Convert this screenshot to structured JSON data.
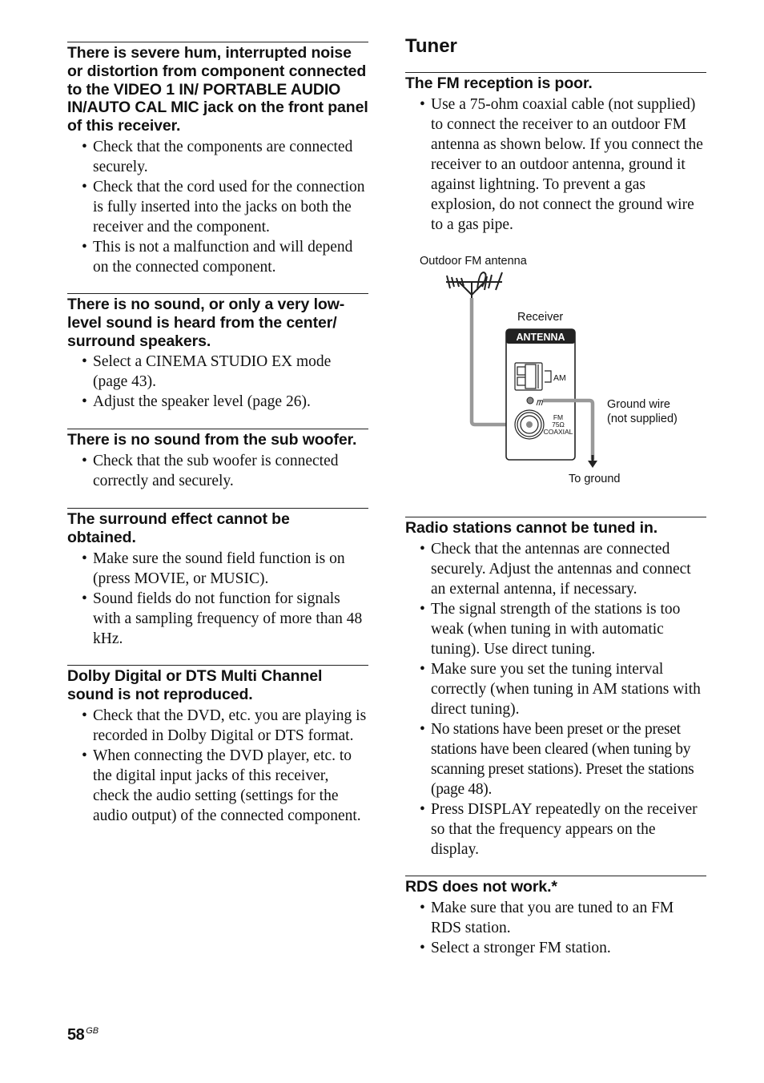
{
  "left_column": {
    "sections": [
      {
        "heading": "There is severe hum, interrupted noise or distortion from component connected to the VIDEO 1 IN/ PORTABLE AUDIO IN/AUTO CAL MIC jack on the front panel of this receiver.",
        "bullets": [
          "Check that the components are connected securely.",
          "Check that the cord used for the connection is fully inserted into the jacks on both the receiver and the component.",
          "This is not a malfunction and will depend on the connected component."
        ]
      },
      {
        "heading": "There is no sound, or only a very low-level sound is heard from the center/ surround speakers.",
        "bullets": [
          "Select a CINEMA STUDIO EX mode (page 43).",
          "Adjust the speaker level (page 26)."
        ]
      },
      {
        "heading": "There is no sound from the sub woofer.",
        "bullets": [
          "Check that the sub woofer is connected correctly and securely."
        ]
      },
      {
        "heading": "The surround effect cannot be obtained.",
        "bullets": [
          "Make sure the sound field function is on (press MOVIE, or MUSIC).",
          "Sound fields do not function for signals with a sampling frequency of more than 48 kHz."
        ]
      },
      {
        "heading": "Dolby Digital or DTS Multi Channel sound is not reproduced.",
        "bullets": [
          "Check that the DVD, etc. you are playing is recorded in Dolby Digital or DTS format.",
          "When connecting the DVD player, etc. to the digital input jacks of this receiver, check the audio setting (settings for the audio output) of the connected component."
        ]
      }
    ]
  },
  "right_column": {
    "title": "Tuner",
    "fm_section": {
      "heading": "The FM reception is poor.",
      "bullets": [
        "Use a 75-ohm coaxial cable (not supplied) to connect the receiver to an outdoor FM antenna as shown below. If you connect the receiver to an outdoor antenna, ground it against lightning. To prevent a gas explosion, do not connect the ground wire to a gas pipe."
      ]
    },
    "diagram": {
      "outdoor_antenna_label": "Outdoor FM antenna",
      "receiver_label": "Receiver",
      "panel_label": "ANTENNA",
      "am_label": "AM",
      "fm_label_1": "FM",
      "fm_label_2": "75Ω",
      "fm_label_3": "COAXIAL",
      "ground_wire_label_1": "Ground wire",
      "ground_wire_label_2": "(not supplied)",
      "to_ground_label": "To ground"
    },
    "sections": [
      {
        "heading": "Radio stations cannot be tuned in.",
        "bullets": [
          "Check that the antennas are connected securely. Adjust the antennas and connect an external antenna, if necessary.",
          "The signal strength of the stations is too weak (when tuning in with automatic tuning). Use direct tuning.",
          "Make sure you set the tuning interval correctly (when tuning in AM stations with direct tuning).",
          "No stations have been preset or the preset stations have been cleared (when tuning by scanning preset stations). Preset the stations (page 48).",
          "Press DISPLAY repeatedly on the receiver so that the frequency appears on the display."
        ]
      },
      {
        "heading": "RDS does not work.*",
        "bullets": [
          "Make sure that you are tuned to an FM RDS station.",
          "Select a stronger FM station."
        ]
      }
    ]
  },
  "footer": {
    "page_number": "58",
    "page_suffix": "GB"
  }
}
